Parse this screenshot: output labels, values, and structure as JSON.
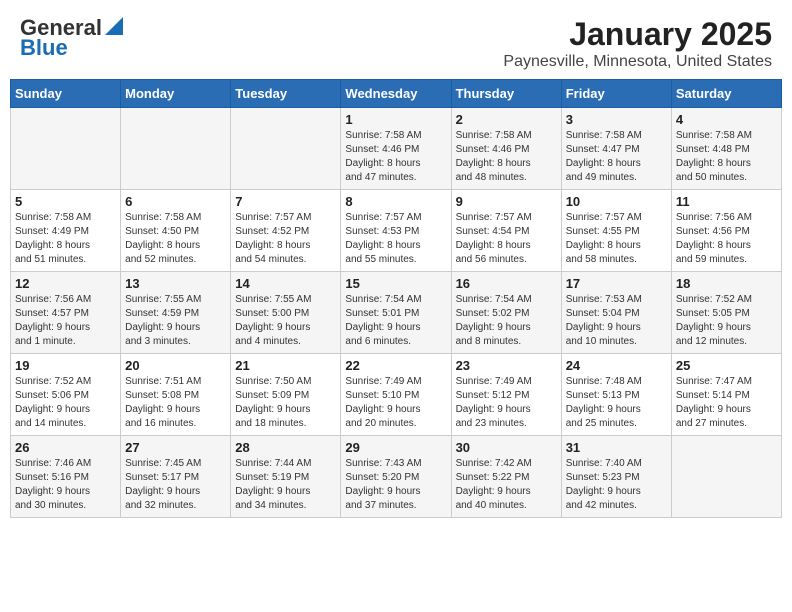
{
  "header": {
    "logo_general": "General",
    "logo_blue": "Blue",
    "title": "January 2025",
    "subtitle": "Paynesville, Minnesota, United States"
  },
  "calendar": {
    "days_of_week": [
      "Sunday",
      "Monday",
      "Tuesday",
      "Wednesday",
      "Thursday",
      "Friday",
      "Saturday"
    ],
    "weeks": [
      [
        {
          "day": "",
          "info": ""
        },
        {
          "day": "",
          "info": ""
        },
        {
          "day": "",
          "info": ""
        },
        {
          "day": "1",
          "info": "Sunrise: 7:58 AM\nSunset: 4:46 PM\nDaylight: 8 hours\nand 47 minutes."
        },
        {
          "day": "2",
          "info": "Sunrise: 7:58 AM\nSunset: 4:46 PM\nDaylight: 8 hours\nand 48 minutes."
        },
        {
          "day": "3",
          "info": "Sunrise: 7:58 AM\nSunset: 4:47 PM\nDaylight: 8 hours\nand 49 minutes."
        },
        {
          "day": "4",
          "info": "Sunrise: 7:58 AM\nSunset: 4:48 PM\nDaylight: 8 hours\nand 50 minutes."
        }
      ],
      [
        {
          "day": "5",
          "info": "Sunrise: 7:58 AM\nSunset: 4:49 PM\nDaylight: 8 hours\nand 51 minutes."
        },
        {
          "day": "6",
          "info": "Sunrise: 7:58 AM\nSunset: 4:50 PM\nDaylight: 8 hours\nand 52 minutes."
        },
        {
          "day": "7",
          "info": "Sunrise: 7:57 AM\nSunset: 4:52 PM\nDaylight: 8 hours\nand 54 minutes."
        },
        {
          "day": "8",
          "info": "Sunrise: 7:57 AM\nSunset: 4:53 PM\nDaylight: 8 hours\nand 55 minutes."
        },
        {
          "day": "9",
          "info": "Sunrise: 7:57 AM\nSunset: 4:54 PM\nDaylight: 8 hours\nand 56 minutes."
        },
        {
          "day": "10",
          "info": "Sunrise: 7:57 AM\nSunset: 4:55 PM\nDaylight: 8 hours\nand 58 minutes."
        },
        {
          "day": "11",
          "info": "Sunrise: 7:56 AM\nSunset: 4:56 PM\nDaylight: 8 hours\nand 59 minutes."
        }
      ],
      [
        {
          "day": "12",
          "info": "Sunrise: 7:56 AM\nSunset: 4:57 PM\nDaylight: 9 hours\nand 1 minute."
        },
        {
          "day": "13",
          "info": "Sunrise: 7:55 AM\nSunset: 4:59 PM\nDaylight: 9 hours\nand 3 minutes."
        },
        {
          "day": "14",
          "info": "Sunrise: 7:55 AM\nSunset: 5:00 PM\nDaylight: 9 hours\nand 4 minutes."
        },
        {
          "day": "15",
          "info": "Sunrise: 7:54 AM\nSunset: 5:01 PM\nDaylight: 9 hours\nand 6 minutes."
        },
        {
          "day": "16",
          "info": "Sunrise: 7:54 AM\nSunset: 5:02 PM\nDaylight: 9 hours\nand 8 minutes."
        },
        {
          "day": "17",
          "info": "Sunrise: 7:53 AM\nSunset: 5:04 PM\nDaylight: 9 hours\nand 10 minutes."
        },
        {
          "day": "18",
          "info": "Sunrise: 7:52 AM\nSunset: 5:05 PM\nDaylight: 9 hours\nand 12 minutes."
        }
      ],
      [
        {
          "day": "19",
          "info": "Sunrise: 7:52 AM\nSunset: 5:06 PM\nDaylight: 9 hours\nand 14 minutes."
        },
        {
          "day": "20",
          "info": "Sunrise: 7:51 AM\nSunset: 5:08 PM\nDaylight: 9 hours\nand 16 minutes."
        },
        {
          "day": "21",
          "info": "Sunrise: 7:50 AM\nSunset: 5:09 PM\nDaylight: 9 hours\nand 18 minutes."
        },
        {
          "day": "22",
          "info": "Sunrise: 7:49 AM\nSunset: 5:10 PM\nDaylight: 9 hours\nand 20 minutes."
        },
        {
          "day": "23",
          "info": "Sunrise: 7:49 AM\nSunset: 5:12 PM\nDaylight: 9 hours\nand 23 minutes."
        },
        {
          "day": "24",
          "info": "Sunrise: 7:48 AM\nSunset: 5:13 PM\nDaylight: 9 hours\nand 25 minutes."
        },
        {
          "day": "25",
          "info": "Sunrise: 7:47 AM\nSunset: 5:14 PM\nDaylight: 9 hours\nand 27 minutes."
        }
      ],
      [
        {
          "day": "26",
          "info": "Sunrise: 7:46 AM\nSunset: 5:16 PM\nDaylight: 9 hours\nand 30 minutes."
        },
        {
          "day": "27",
          "info": "Sunrise: 7:45 AM\nSunset: 5:17 PM\nDaylight: 9 hours\nand 32 minutes."
        },
        {
          "day": "28",
          "info": "Sunrise: 7:44 AM\nSunset: 5:19 PM\nDaylight: 9 hours\nand 34 minutes."
        },
        {
          "day": "29",
          "info": "Sunrise: 7:43 AM\nSunset: 5:20 PM\nDaylight: 9 hours\nand 37 minutes."
        },
        {
          "day": "30",
          "info": "Sunrise: 7:42 AM\nSunset: 5:22 PM\nDaylight: 9 hours\nand 40 minutes."
        },
        {
          "day": "31",
          "info": "Sunrise: 7:40 AM\nSunset: 5:23 PM\nDaylight: 9 hours\nand 42 minutes."
        },
        {
          "day": "",
          "info": ""
        }
      ]
    ]
  }
}
